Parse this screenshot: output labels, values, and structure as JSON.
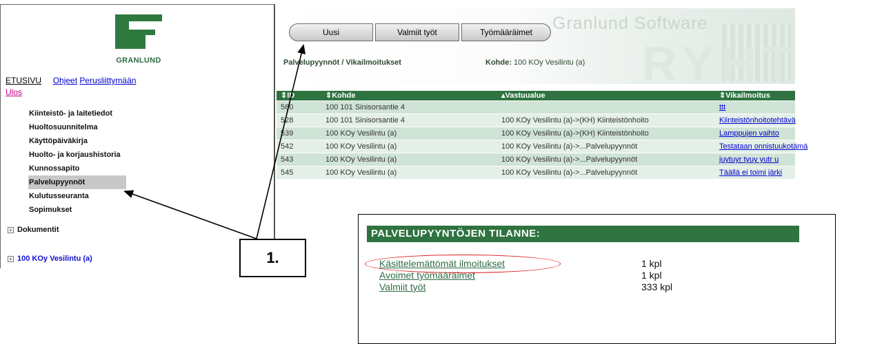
{
  "brand": {
    "logo_text": "GRANLUND"
  },
  "nav": {
    "top_links": [
      "ETUSIVU",
      "Ohjeet",
      "Perusliittymään"
    ],
    "logout": "Ulos",
    "items": [
      "Kiinteistö- ja laitetiedot",
      "Huoltosuunnitelma",
      "Käyttöpäiväkirja",
      "Huolto- ja korjaushistoria",
      "Kunnossapito",
      "Palvelupyynnöt",
      "Kulutusseuranta",
      "Sopimukset"
    ],
    "active_item": "Palvelupyynnöt",
    "tree": [
      "Dokumentit",
      "100 KOy Vesilintu (a)"
    ]
  },
  "header": {
    "buttons": [
      "Uusi",
      "Valmiit työt",
      "Työmääräimet"
    ],
    "brand_text": "Granlund Software",
    "product_text": "RYHTI",
    "breadcrumb": "Palvelupyynnöt / Vikailmoitukset",
    "kohde_label": "Kohde:",
    "kohde_value": "100 KOy Vesilintu (a)"
  },
  "table": {
    "columns": [
      "⇕ID",
      "⇕Kohde",
      "▴Vastuualue",
      "⇕Vikailmoitus"
    ],
    "rows": [
      [
        "560",
        "100 101 Sinisorsantie 4",
        "",
        "ttt"
      ],
      [
        "528",
        "100 101 Sinisorsantie 4",
        "100 KOy Vesilintu (a)->(KH) Kiinteistönhoito",
        "Kiinteistönhoitotehtävä"
      ],
      [
        "539",
        "100 KOy Vesilintu (a)",
        "100 KOy Vesilintu (a)->(KH) Kiinteistönhoito",
        "Lamppujen vaihto"
      ],
      [
        "542",
        "100 KOy Vesilintu (a)",
        "100 KOy Vesilintu (a)->...Palvelupyynnöt",
        "Testataan onnistuukotämä"
      ],
      [
        "543",
        "100 KOy Vesilintu (a)",
        "100 KOy Vesilintu (a)->...Palvelupyynnöt",
        "juytuyr tyuy yutr u"
      ],
      [
        "545",
        "100 KOy Vesilintu (a)",
        "100 KOy Vesilintu (a)->...Palvelupyynnöt",
        "Täällä ei toimi järki"
      ]
    ]
  },
  "status": {
    "title": "PALVELUPYYNTÖJEN TILANNE:",
    "rows": [
      {
        "label": "Käsittelemättömät ilmoitukset",
        "count": "1 kpl"
      },
      {
        "label": "Avoimet työmääräimet",
        "count": "1 kpl"
      },
      {
        "label": "Valmiit työt",
        "count": "333 kpl"
      }
    ]
  },
  "callout": {
    "label": "1."
  },
  "colors": {
    "accent_green": "#2e7340",
    "highlight_red": "#e02020",
    "link_blue": "#0000cc"
  }
}
